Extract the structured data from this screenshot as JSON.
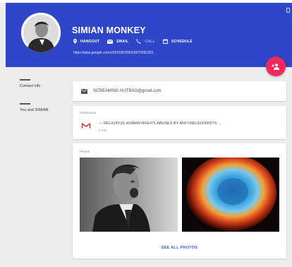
{
  "header": {
    "name": "SIMIAN MONKEY",
    "actions": [
      {
        "label": "HANGOUT",
        "icon": "location-icon"
      },
      {
        "label": "EMAIL",
        "icon": "email-icon"
      },
      {
        "label": "CALL",
        "icon": "phone-icon"
      },
      {
        "label": "SCHEDULE",
        "icon": "calendar-icon"
      }
    ],
    "profile_url": "https://plus.google.com/u/0/1106709916070681281",
    "color": "#2f46c8"
  },
  "fab": {
    "icon": "add-person-icon",
    "color": "#f22a5c"
  },
  "nav": {
    "items": [
      {
        "label": "Contact info"
      },
      {
        "label": "You and SIMIAN"
      }
    ]
  },
  "contact": {
    "email": "SCREAMING.NUTBAG@gmail.com",
    "icon": "email-icon"
  },
  "interactions": {
    "label": "Interactions",
    "item": {
      "title": "— RELIGIOUS HUMAN RIGHTS ABUSES BY ANTI-RELIGIONISTS ...",
      "date": "6 Feb",
      "icon": "gmail-icon"
    }
  },
  "photos": {
    "label": "Photos",
    "items": [
      {
        "description": "black-and-white photo of a shouting man"
      },
      {
        "description": "colorful nebula"
      }
    ],
    "see_all_label": "SEE ALL PHOTOS"
  }
}
